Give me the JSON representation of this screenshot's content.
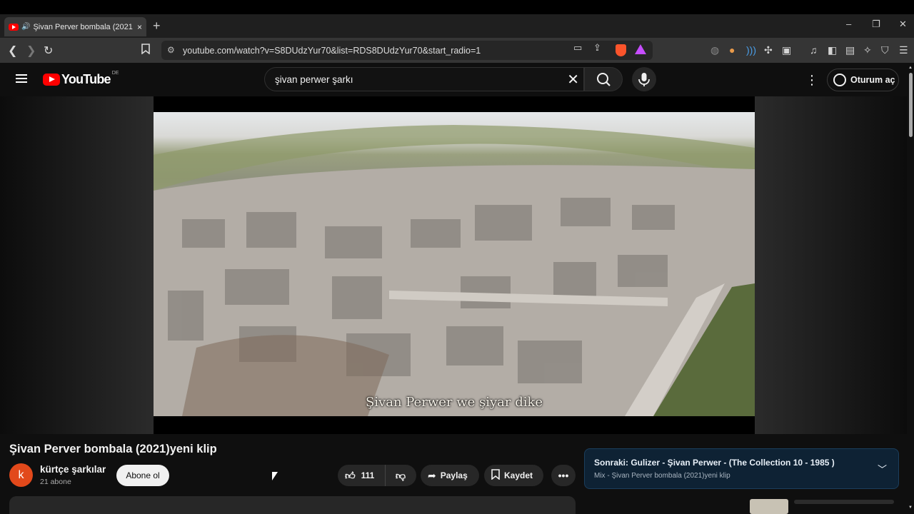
{
  "browser": {
    "tab_title": "Şivan Perver bombala (2021)y",
    "url": "youtube.com/watch?v=S8DUdzYur70&list=RDS8DUdzYur70&start_radio=1",
    "new_tab_label": "+",
    "tab_close_label": "×"
  },
  "youtube": {
    "logo_word": "YouTube",
    "country_code": "DE",
    "search_value": "şivan perwer şarkı",
    "sign_in_label": "Oturum aç"
  },
  "video": {
    "subtitle": "Şivan Perwer we şiyar dike",
    "title": "Şivan Perver bombala (2021)yeni klip",
    "channel_name": "kürtçe şarkılar",
    "channel_initial": "k",
    "subscribers": "21 abone",
    "subscribe_label": "Abone ol",
    "like_count": "111",
    "share_label": "Paylaş",
    "save_label": "Kaydet"
  },
  "up_next": {
    "title": "Sonraki: Gulizer - Şivan Perwer - (The Collection 10 - 1985 )",
    "subtitle": "Mix - Şivan Perver bombala (2021)yeni klip"
  },
  "colors": {
    "brand_red": "#ff0000",
    "avatar_orange": "#e2491b",
    "next_card_bg": "#0e2234"
  }
}
